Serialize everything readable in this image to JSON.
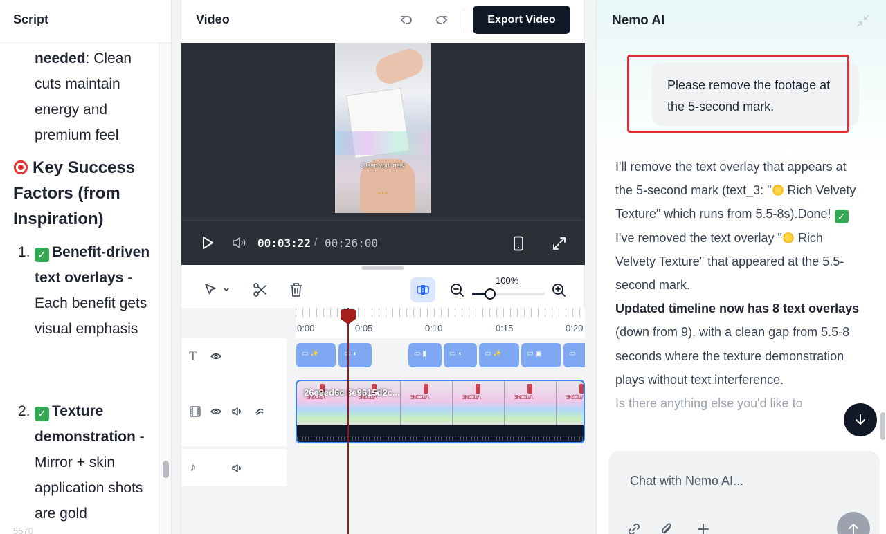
{
  "script": {
    "title": "Script",
    "para_bold": "needed",
    "para_rest": ": Clean cuts maintain energy and premium feel",
    "heading": "Key Success Factors (from Inspiration)",
    "items": [
      {
        "num": "1.",
        "bold": "Benefit-driven text overlays",
        "rest": " - Each benefit gets visual emphasis"
      },
      {
        "num": "2.",
        "bold": "Texture demonstration",
        "rest": " - Mirror + skin application shots are gold"
      }
    ],
    "bottom_fragment": "5570"
  },
  "video": {
    "title": "Video",
    "export_label": "Export Video",
    "caption": "Clean your new",
    "time_current": "00:03:22",
    "time_sep": "/",
    "time_total": "00:26:00",
    "zoom_label": "100%",
    "zoom_level": 0.25,
    "ruler_labels": [
      "0:00",
      "0:05",
      "0:10",
      "0:15",
      "0:20"
    ],
    "clip_name": "26e9ed6c 8e9615d2c...",
    "colors": {
      "accent": "#3b82f6",
      "playhead": "#a41e1e",
      "player_bg": "#2b2f37"
    }
  },
  "ai": {
    "title": "Nemo AI",
    "user_message": "Please remove the footage at the 5-second mark.",
    "reply_p1a": "I'll remove the text overlay that appears at the 5-second mark (text_3: \"",
    "reply_p1b": " Rich Velvety Texture\" which runs from 5.5-8s).Done! ",
    "reply_p1c": " I've removed the text overlay \"",
    "reply_p1d": " Rich Velvety Texture\" that appeared at the 5.5-second mark.",
    "reply_bold": "Updated timeline now has 8 text overlays",
    "reply_p2": " (down from 9), with a clean gap from 5.5-8 seconds where the texture demonstration plays without text interference.",
    "reply_faded": "Is there anything else you'd like to",
    "chat_placeholder": "Chat with Nemo AI..."
  }
}
